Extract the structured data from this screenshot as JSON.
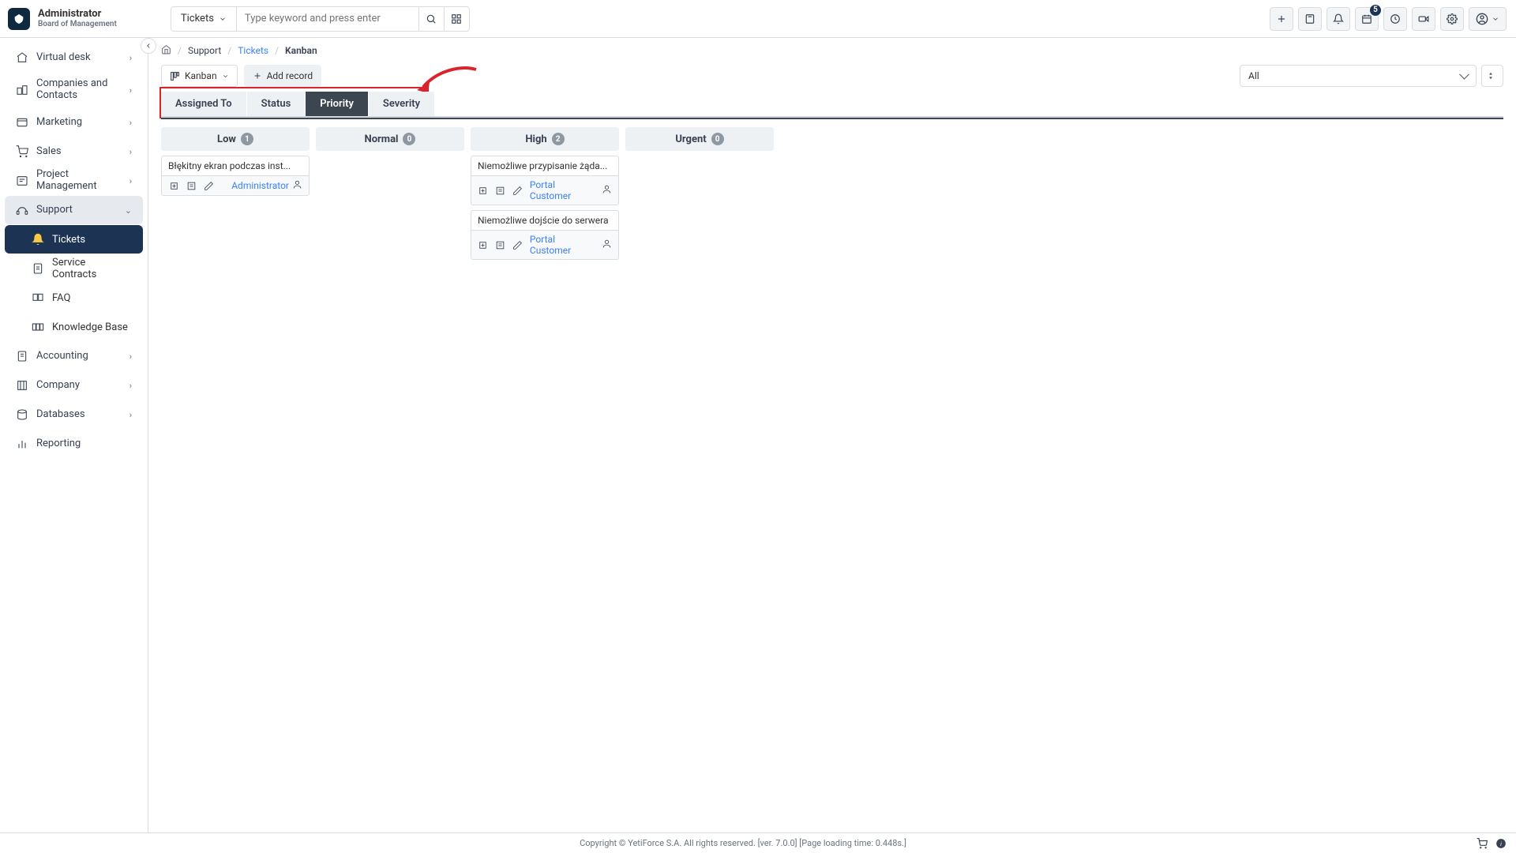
{
  "header": {
    "brand_title": "Administrator",
    "brand_subtitle": "Board of Management",
    "module_selector": "Tickets",
    "search_placeholder": "Type keyword and press enter",
    "calendar_badge": "5"
  },
  "sidebar": {
    "items": [
      {
        "label": "Virtual desk",
        "expandable": true
      },
      {
        "label": "Companies and Contacts",
        "expandable": true,
        "tall": true
      },
      {
        "label": "Marketing",
        "expandable": true
      },
      {
        "label": "Sales",
        "expandable": true
      },
      {
        "label": "Project Management",
        "expandable": true
      },
      {
        "label": "Support",
        "expandable": true,
        "selected": true
      },
      {
        "label": "Accounting",
        "expandable": true
      },
      {
        "label": "Company",
        "expandable": true
      },
      {
        "label": "Databases",
        "expandable": true
      },
      {
        "label": "Reporting",
        "expandable": false
      }
    ],
    "support_children": [
      {
        "label": "Tickets",
        "active": true
      },
      {
        "label": "Service Contracts"
      },
      {
        "label": "FAQ"
      },
      {
        "label": "Knowledge Base"
      }
    ]
  },
  "breadcrumbs": {
    "home_aria": "Home",
    "module": "Support",
    "parent": "Tickets",
    "current": "Kanban"
  },
  "toolbar": {
    "view_button": "Kanban",
    "add_record": "Add record",
    "filter_selected": "All"
  },
  "tabs": [
    {
      "label": "Assigned To"
    },
    {
      "label": "Status"
    },
    {
      "label": "Priority",
      "active": true
    },
    {
      "label": "Severity"
    }
  ],
  "kanban": {
    "columns": [
      {
        "name": "Low",
        "count": "1",
        "cards": [
          {
            "title": "Błękitny ekran podczas inst...",
            "assignee": "Administrator"
          }
        ]
      },
      {
        "name": "Normal",
        "count": "0",
        "cards": []
      },
      {
        "name": "High",
        "count": "2",
        "cards": [
          {
            "title": "Niemożliwe przypisanie żąda...",
            "assignee": "Portal Customer"
          },
          {
            "title": "Niemożliwe dojście do serwera",
            "assignee": "Portal Customer"
          }
        ]
      },
      {
        "name": "Urgent",
        "count": "0",
        "cards": []
      }
    ]
  },
  "footer": {
    "text": "Copyright © YetiForce S.A. All rights reserved. [ver. 7.0.0] [Page loading time: 0.448s.]"
  }
}
